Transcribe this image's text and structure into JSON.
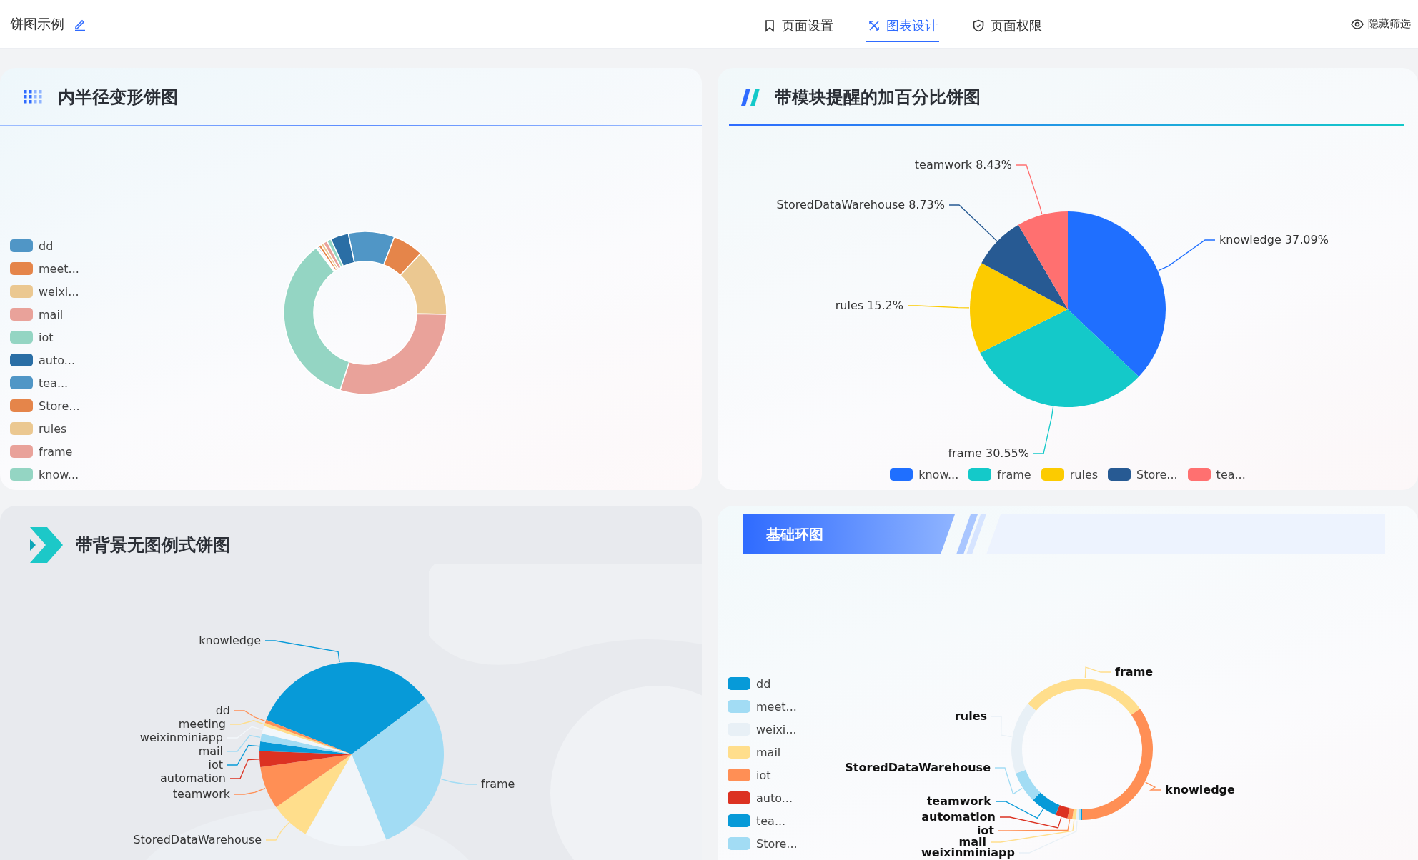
{
  "header": {
    "title": "饼图示例",
    "tabs": [
      {
        "label": "页面设置",
        "selected": false
      },
      {
        "label": "图表设计",
        "selected": true
      },
      {
        "label": "页面权限",
        "selected": false
      }
    ],
    "hide_filter": "隐藏筛选"
  },
  "cards": [
    {
      "kind": "ring",
      "title": "内半径变形饼图",
      "legend": [
        {
          "label": "dd",
          "color": "#5096c6"
        },
        {
          "label": "meet...",
          "color": "#e5854a"
        },
        {
          "label": "weixi...",
          "color": "#ebc891"
        },
        {
          "label": "mail",
          "color": "#e9a29a"
        },
        {
          "label": "iot",
          "color": "#94d5c3"
        },
        {
          "label": "auto...",
          "color": "#2a6ea5"
        },
        {
          "label": "tea...",
          "color": "#5096c6"
        },
        {
          "label": "Store...",
          "color": "#e5854a"
        },
        {
          "label": "rules",
          "color": "#ebc891"
        },
        {
          "label": "frame",
          "color": "#e9a29a"
        },
        {
          "label": "know...",
          "color": "#94d5c3"
        }
      ]
    },
    {
      "kind": "percent",
      "title": "带模块提醒的加百分比饼图",
      "chart_data": {
        "type": "pie",
        "categories": [
          "knowledge",
          "frame",
          "rules",
          "StoredDataWarehouse",
          "teamwork"
        ],
        "values": [
          37.09,
          30.55,
          15.2,
          8.73,
          8.43
        ],
        "value_labels": [
          "37.09%",
          "30.55%",
          "15.2%",
          "8.73%",
          "8.43%"
        ]
      },
      "legend": [
        {
          "label": "know...",
          "color": "#1f6fff"
        },
        {
          "label": "frame",
          "color": "#14c9c9"
        },
        {
          "label": "rules",
          "color": "#fccb00"
        },
        {
          "label": "Store...",
          "color": "#275a93"
        },
        {
          "label": "tea...",
          "color": "#ff7070"
        }
      ]
    },
    {
      "kind": "backdrop",
      "title": "带背景无图例式饼图",
      "labels": [
        {
          "label": "knowledge",
          "color": "#079ad8"
        },
        {
          "label": "dd",
          "color": "#ff8f55"
        },
        {
          "label": "meeting",
          "color": "#ffde8c"
        },
        {
          "label": "weixinminiapp",
          "color": "#f2f7fb"
        },
        {
          "label": "mail",
          "color": "#a2dcf4"
        },
        {
          "label": "iot",
          "color": "#079ad8"
        },
        {
          "label": "automation",
          "color": "#dc3222"
        },
        {
          "label": "teamwork",
          "color": "#ff8f55"
        },
        {
          "label": "StoredDataWarehouse",
          "color": "#ffde8c"
        },
        {
          "label": "frame",
          "color": "#a2dcf4"
        }
      ]
    },
    {
      "kind": "banner",
      "title": "基础环图",
      "legend": [
        {
          "label": "dd",
          "color": "#079ad8"
        },
        {
          "label": "meet...",
          "color": "#a2dcf4"
        },
        {
          "label": "weixi...",
          "color": "#e8f0f6"
        },
        {
          "label": "mail",
          "color": "#ffde8c"
        },
        {
          "label": "iot",
          "color": "#ff8f55"
        },
        {
          "label": "auto...",
          "color": "#dc3222"
        },
        {
          "label": "tea...",
          "color": "#079ad8"
        },
        {
          "label": "Store...",
          "color": "#a2dcf4"
        }
      ],
      "labels": [
        {
          "label": "frame",
          "color": "#ffde8c"
        },
        {
          "label": "rules",
          "color": "#e8f0f6"
        },
        {
          "label": "StoredDataWarehouse",
          "color": "#a2dcf4"
        },
        {
          "label": "knowledge",
          "color": "#ff8f55"
        },
        {
          "label": "teamwork",
          "color": "#079ad8"
        },
        {
          "label": "automation",
          "color": "#dc3222"
        },
        {
          "label": "iot",
          "color": "#ff8f55"
        },
        {
          "label": "mail",
          "color": "#ffde8c"
        },
        {
          "label": "weixinminiapp",
          "color": "#e8f0f6"
        }
      ]
    }
  ]
}
